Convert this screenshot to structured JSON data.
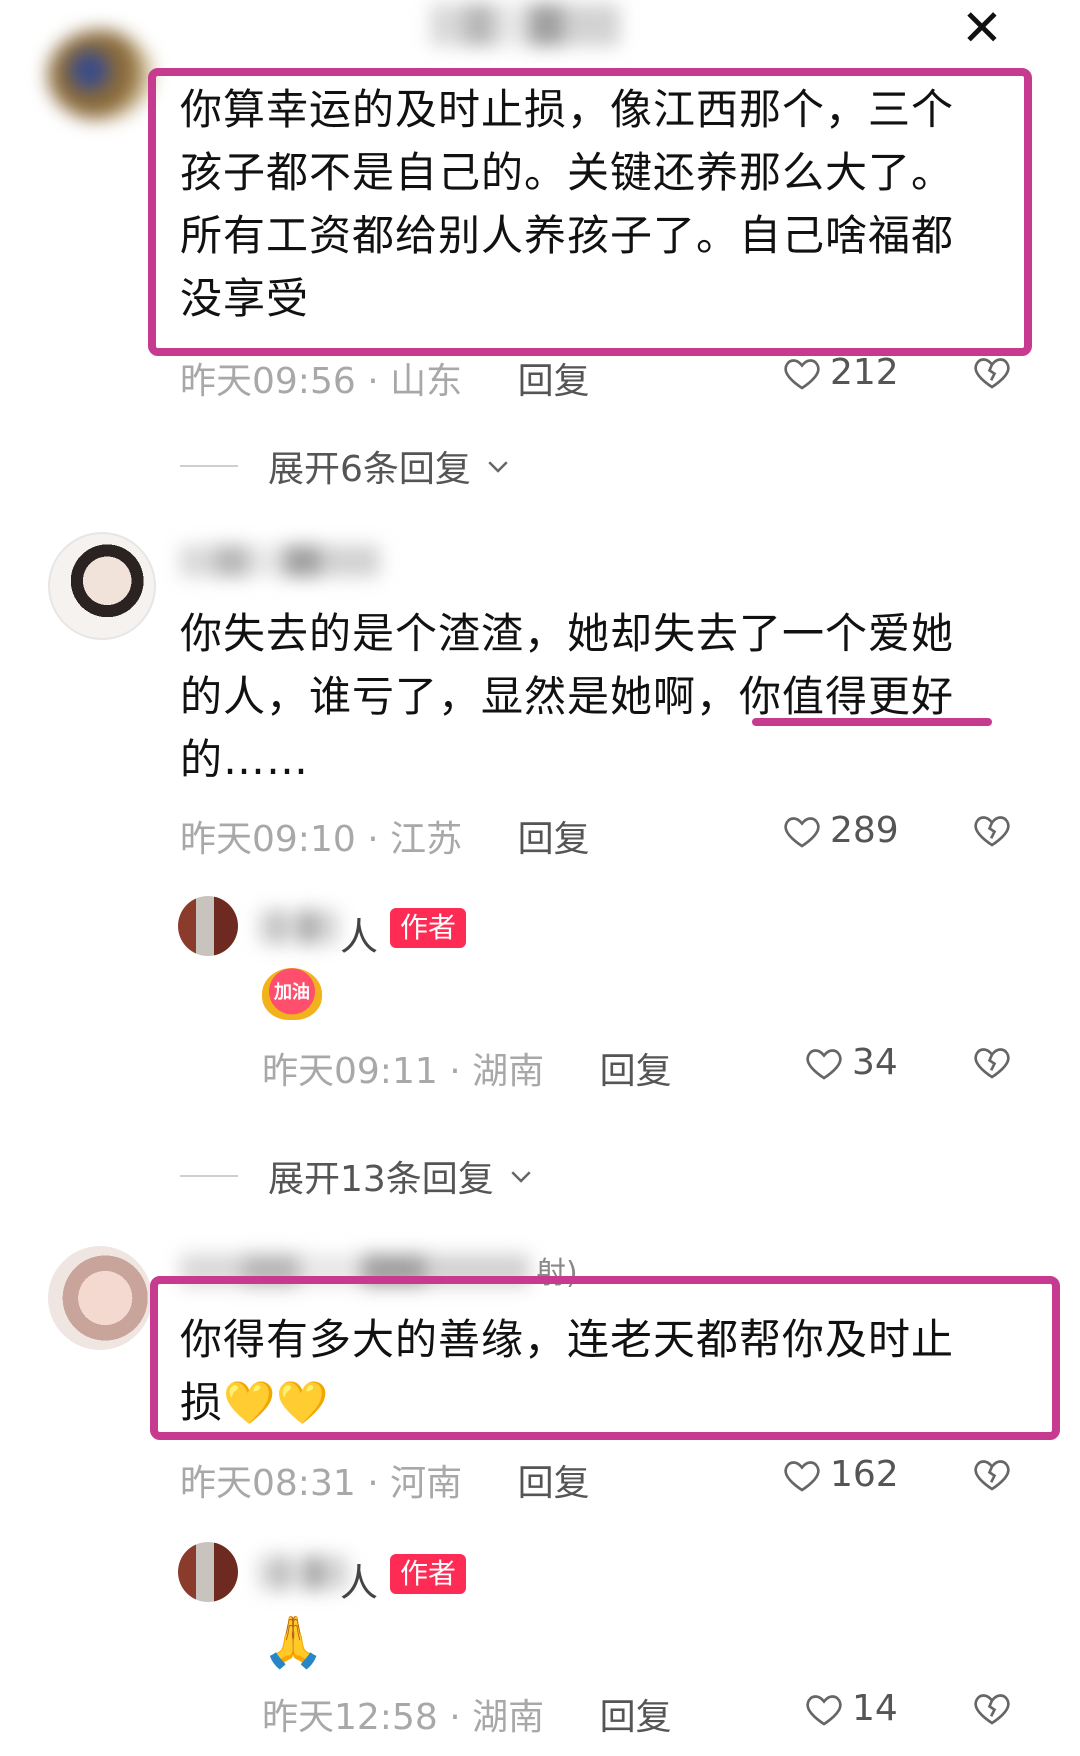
{
  "header": {
    "close_label": "✕"
  },
  "comments": [
    {
      "text": "你算幸运的及时止损，像江西那个，三个孩子都不是自己的。关键还养那么大了。所有工资都给别人养孩子了。自己啥福都没享受",
      "time": "昨天09:56",
      "region": "山东",
      "reply_label": "回复",
      "likes": "212",
      "expand_label": "展开6条回复"
    },
    {
      "text": "你失去的是个渣渣，她却失去了一个爱她的人，谁亏了，显然是她啊，你值得更好的……",
      "time": "昨天09:10",
      "region": "江苏",
      "reply_label": "回复",
      "likes": "289",
      "reply": {
        "name_visible": "人",
        "badge": "作者",
        "sticker_text": "加油",
        "time": "昨天09:11",
        "region": "湖南",
        "reply_label": "回复",
        "likes": "34"
      },
      "expand_label": "展开13条回复"
    },
    {
      "text": "你得有多大的善缘，连老天都帮你及时止损💛💛",
      "name_fragment": "射)",
      "time": "昨天08:31",
      "region": "河南",
      "reply_label": "回复",
      "likes": "162",
      "reply": {
        "name_visible": "人",
        "badge": "作者",
        "emoji": "🙏",
        "time": "昨天12:58",
        "region": "湖南",
        "reply_label": "回复",
        "likes": "14"
      }
    }
  ],
  "colors": {
    "highlight": "#c63b8f",
    "author_badge": "#fe2c55",
    "meta_gray": "#a8a8a8"
  },
  "icons": {
    "heart": "heart-icon",
    "dislike": "broken-heart-icon",
    "chevron": "chevron-down-icon"
  }
}
